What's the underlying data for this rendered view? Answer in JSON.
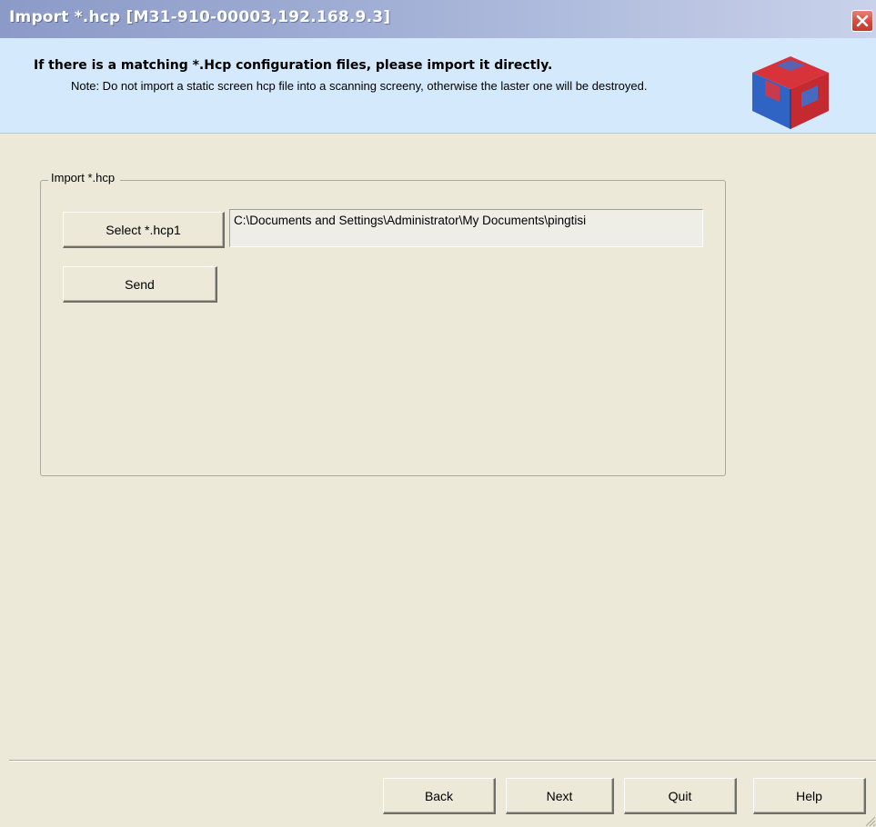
{
  "window": {
    "title": "Import *.hcp [M31-910-00003,192.168.9.3]",
    "close_icon": "close-x-icon"
  },
  "header": {
    "title": "If there is a matching *.Hcp configuration files, please import it directly.",
    "note": "Note: Do not import a static screen hcp file into a scanning screeny, otherwise the laster one will be destroyed.",
    "logo_icon": "cube-3d-icon"
  },
  "import_group": {
    "legend": "Import *.hcp",
    "select_button": "Select *.hcp1",
    "file_path": "C:\\Documents and Settings\\Administrator\\My Documents\\pingtisi",
    "send_button": "Send"
  },
  "footer": {
    "back": "Back",
    "next": "Next",
    "quit": "Quit",
    "help": "Help"
  },
  "colors": {
    "title_bar": "#8b9ac7",
    "header_band": "#d4e9fb",
    "window_bg": "#ece9d8",
    "close_button": "#d5493c"
  }
}
